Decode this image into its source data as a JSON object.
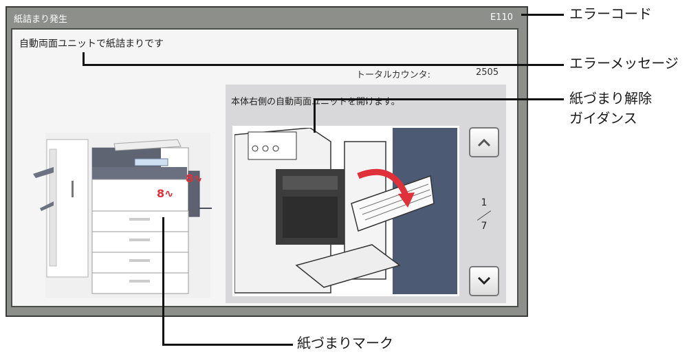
{
  "screen": {
    "title": "紙詰まり発生",
    "error_code": "E110",
    "message": "自動両面ユニットで紙詰まりです",
    "counter_label": "トータルカウンタ:",
    "counter_value": "2505",
    "guidance": {
      "text": "本体右側の自動両面ユニットを開けます。",
      "page_current": "1",
      "page_total": "7",
      "up_icon": "chevron-up-icon",
      "down_icon": "chevron-down-icon"
    }
  },
  "callouts": {
    "error_code": "エラーコード",
    "error_message": "エラーメッセージ",
    "guidance_line1": "紙づまり解除",
    "guidance_line2": "ガイダンス",
    "jam_mark": "紙づまりマーク"
  },
  "colors": {
    "frame": "#8c8f8a",
    "panel": "#f5f5f5",
    "guide_bg": "#d8d8da",
    "jam_mark": "#e0303a",
    "photo_bg": "#4d5a73"
  }
}
